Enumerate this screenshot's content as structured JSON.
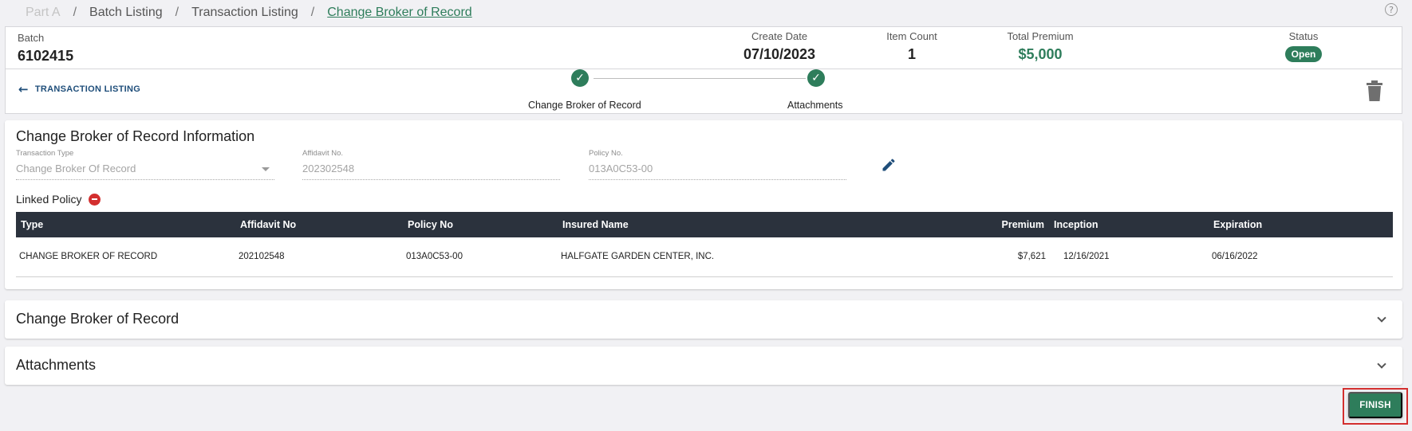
{
  "breadcrumb": {
    "items": [
      "Part A",
      "Batch Listing",
      "Transaction Listing",
      "Change Broker of Record"
    ],
    "separator": "/"
  },
  "help_icon": "?",
  "batch": {
    "label": "Batch",
    "number": "6102415",
    "create_date_label": "Create Date",
    "create_date": "07/10/2023",
    "item_count_label": "Item Count",
    "item_count": "1",
    "total_premium_label": "Total Premium",
    "total_premium": "$5,000",
    "status_label": "Status",
    "status": "Open"
  },
  "nav": {
    "back_label": "TRANSACTION LISTING",
    "back_icon": "arrow-left-icon",
    "steps": [
      {
        "label": "Change Broker of Record",
        "complete": true
      },
      {
        "label": "Attachments",
        "complete": true
      }
    ],
    "check_glyph": "✓",
    "trash_icon": "trash-icon"
  },
  "info": {
    "title": "Change Broker of Record Information",
    "transaction_type_label": "Transaction Type",
    "transaction_type_value": "Change Broker Of Record",
    "affidavit_label": "Affidavit No.",
    "affidavit_value": "202302548",
    "policy_label": "Policy No.",
    "policy_value": "013A0C53-00",
    "edit_icon": "pencil-icon",
    "linked_policy_label": "Linked Policy"
  },
  "table": {
    "headers": {
      "type": "Type",
      "affidavit": "Affidavit No",
      "policy": "Policy No",
      "insured": "Insured Name",
      "premium": "Premium",
      "inception": "Inception",
      "expiration": "Expiration"
    },
    "rows": [
      {
        "type": "CHANGE BROKER OF RECORD",
        "affidavit": "202102548",
        "policy": "013A0C53-00",
        "insured": "HALFGATE GARDEN CENTER, INC.",
        "premium": "$7,621",
        "inception": "12/16/2021",
        "expiration": "06/16/2022"
      }
    ]
  },
  "sections": [
    {
      "title": "Change Broker of Record"
    },
    {
      "title": "Attachments"
    }
  ],
  "finish_label": "FINISH",
  "colors": {
    "accent_green": "#2e7d5b",
    "table_header": "#2b323d",
    "link_blue": "#1f4e7a",
    "danger_red": "#d32f2f"
  }
}
